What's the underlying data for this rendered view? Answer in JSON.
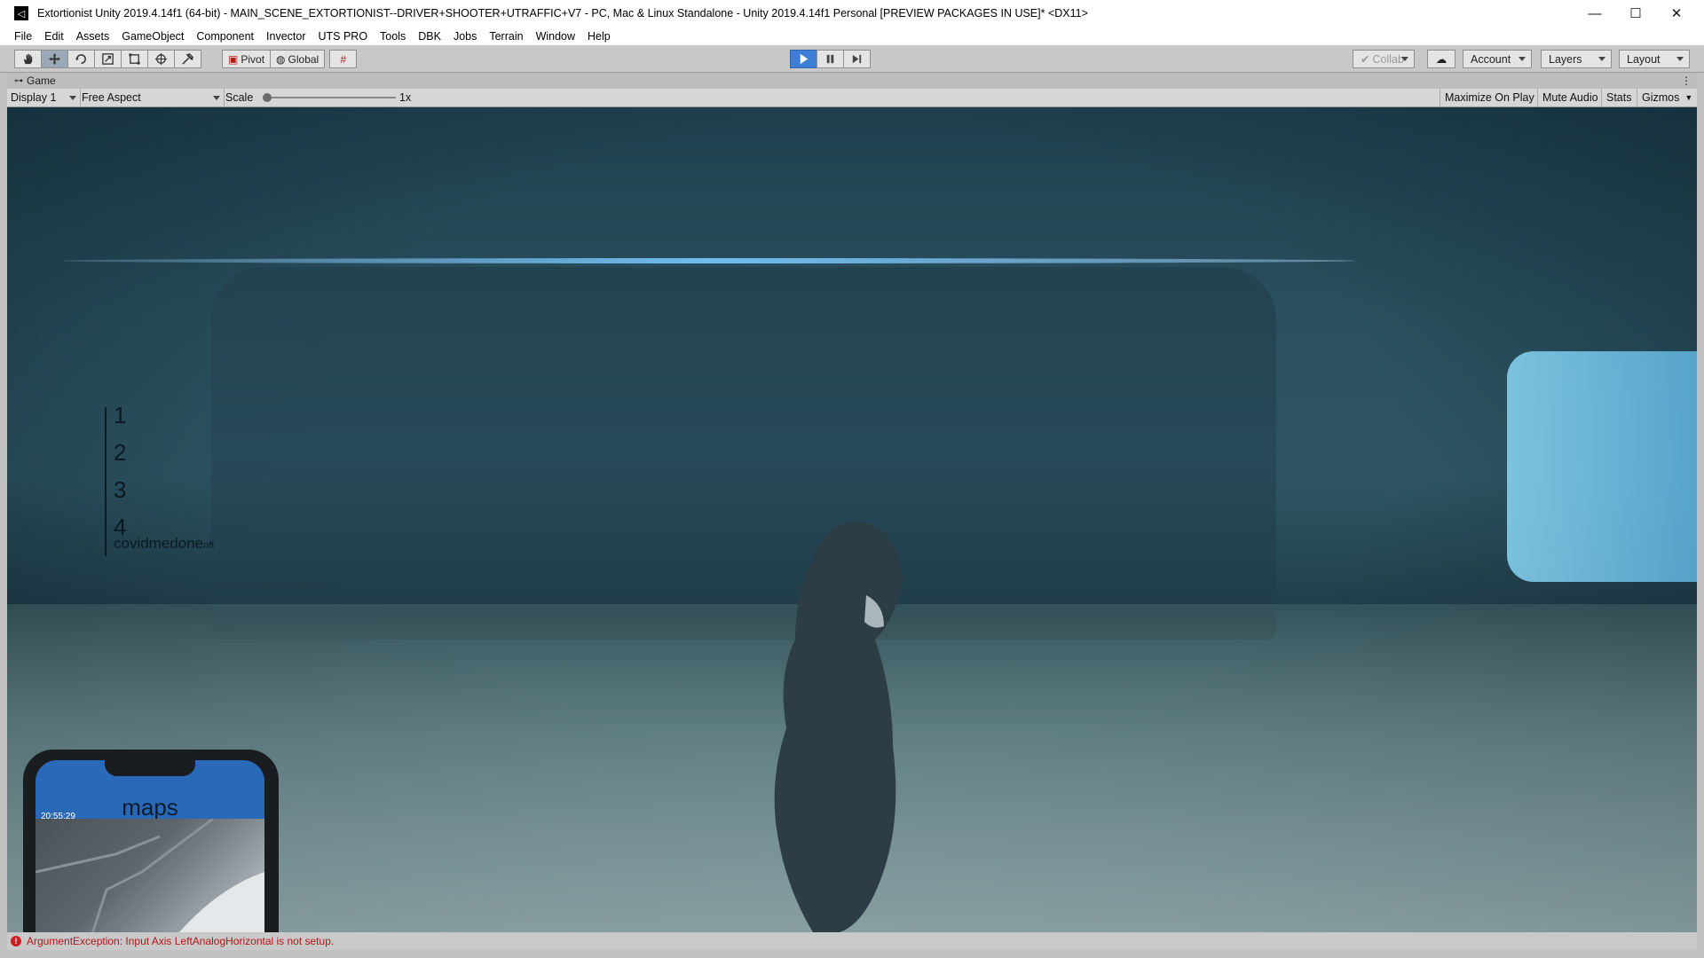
{
  "window": {
    "title": "Extortionist Unity 2019.4.14f1 (64-bit) - MAIN_SCENE_EXTORTIONIST--DRIVER+SHOOTER+UTRAFFIC+V7 - PC, Mac & Linux Standalone - Unity 2019.4.14f1 Personal [PREVIEW PACKAGES IN USE]* <DX11>",
    "minimize": "—",
    "maximize": "☐",
    "close": "✕"
  },
  "menu": [
    "File",
    "Edit",
    "Assets",
    "GameObject",
    "Component",
    "Invector",
    "UTS PRO",
    "Tools",
    "DBK",
    "Jobs",
    "Terrain",
    "Window",
    "Help"
  ],
  "toolbar": {
    "pivot_label": "Pivot",
    "global_label": "Global",
    "collab_label": "Collab",
    "account_label": "Account",
    "layers_label": "Layers",
    "layout_label": "Layout"
  },
  "game_tab": {
    "label": "Game"
  },
  "game_bar": {
    "display": "Display 1",
    "aspect": "Free Aspect",
    "scale_label": "Scale",
    "scale_value": "1x",
    "maximize_on_play": "Maximize On Play",
    "mute_audio": "Mute Audio",
    "stats": "Stats",
    "gizmos": "Gizmos"
  },
  "hud": {
    "numbers": [
      "1",
      "2",
      "3",
      "4"
    ],
    "brand": "covidmedone",
    "brand_suffix": "nft"
  },
  "phone": {
    "time": "20:55:29",
    "title": "maps"
  },
  "console": {
    "message": "ArgumentException: Input Axis LeftAnalogHorizontal is not setup."
  },
  "colors": {
    "play_accent": "#3d7fd6",
    "error": "#b01818",
    "phone_header": "#2a68b8"
  }
}
